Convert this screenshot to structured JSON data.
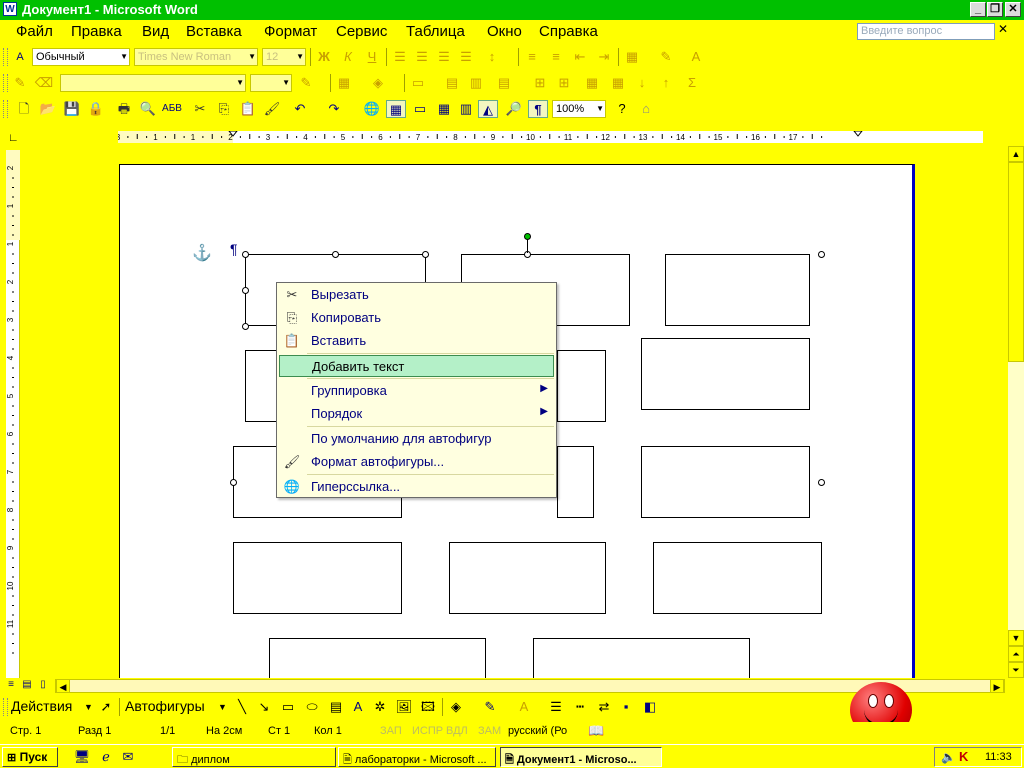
{
  "window": {
    "title": "Документ1 - Microsoft Word"
  },
  "menubar": {
    "items": [
      "Файл",
      "Правка",
      "Вид",
      "Вставка",
      "Формат",
      "Сервис",
      "Таблица",
      "Окно",
      "Справка"
    ],
    "help_placeholder": "Введите вопрос"
  },
  "formatting": {
    "style": "Обычный",
    "font": "Times New Roman",
    "size": "12"
  },
  "standard": {
    "zoom": "100%"
  },
  "ruler": {
    "top_numbers": [
      "3",
      "1",
      "1",
      "2",
      "3",
      "4",
      "5",
      "6",
      "7",
      "8",
      "9",
      "10",
      "11",
      "12",
      "13",
      "14",
      "15",
      "16",
      "17"
    ],
    "left_numbers": [
      "2",
      "1",
      "1",
      "2",
      "3",
      "4",
      "5",
      "6",
      "7",
      "8",
      "9",
      "10",
      "11"
    ]
  },
  "context_menu": {
    "items": [
      {
        "label": "Вырезать",
        "icon": "scissors-icon"
      },
      {
        "label": "Копировать",
        "icon": "copy-icon"
      },
      {
        "label": "Вставить",
        "icon": "paste-icon"
      },
      {
        "label": "Добавить текст",
        "icon": "",
        "highlighted": true
      },
      {
        "label": "Группировка",
        "icon": "",
        "submenu": true
      },
      {
        "label": "Порядок",
        "icon": "",
        "submenu": true
      },
      {
        "label": "По умолчанию для автофигур",
        "icon": ""
      },
      {
        "label": "Формат автофигуры...",
        "icon": "format-shape-icon"
      },
      {
        "label": "Гиперссылка...",
        "icon": "hyperlink-icon"
      }
    ]
  },
  "drawing": {
    "actions_label": "Действия",
    "autoshapes_label": "Автофигуры"
  },
  "status": {
    "page": "Стр. 1",
    "section": "Разд 1",
    "pages": "1/1",
    "at": "На 2см",
    "line": "Ст 1",
    "col": "Кол 1",
    "rec": "ЗАП",
    "trk": "ИСПР",
    "ext": "ВДЛ",
    "ovr": "ЗАМ",
    "language": "русский (Ро"
  },
  "taskbar": {
    "start": "Пуск",
    "tasks": [
      "диплом",
      "лабораторки - Microsoft ...",
      "Документ1 - Microso..."
    ],
    "clock": "11:33"
  },
  "colors": {
    "titlebar": "#00c000",
    "workspace": "#ffff00",
    "menu_highlight": "#b4f0c8"
  }
}
